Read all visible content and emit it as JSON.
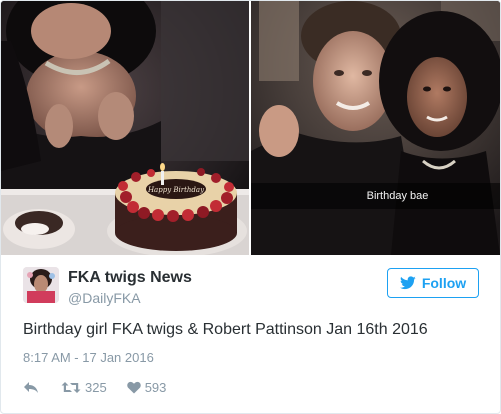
{
  "photos": {
    "caption": "Birthday bae",
    "cake_icing": "Happy Birthday"
  },
  "author": {
    "display_name": "FKA twigs News",
    "screen_name": "@DailyFKA"
  },
  "follow": {
    "label": "Follow",
    "icon": "twitter-bird-icon"
  },
  "tweet": {
    "text": "Birthday girl FKA twigs & Robert Pattinson Jan 16th 2016",
    "timestamp": "8:17 AM - 17 Jan 2016"
  },
  "actions": {
    "reply_icon": "reply-icon",
    "retweet_icon": "retweet-icon",
    "retweet_count": "325",
    "like_icon": "heart-icon",
    "like_count": "593"
  },
  "colors": {
    "twitter_blue": "#1da1f2",
    "text_primary": "#292f33",
    "text_secondary": "#8899a6",
    "border": "#e1e8ed"
  }
}
